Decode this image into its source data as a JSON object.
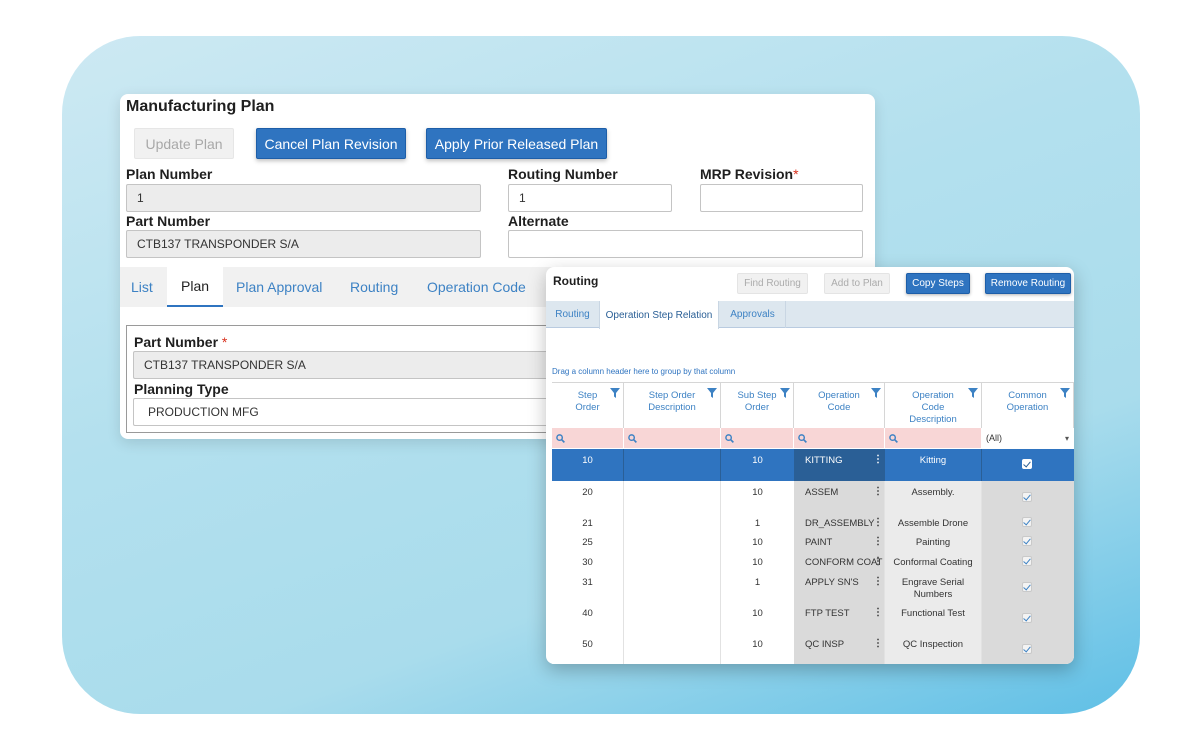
{
  "plan_window": {
    "title": "Manufacturing Plan",
    "buttons": {
      "update_plan": "Update Plan",
      "cancel_revision": "Cancel Plan Revision",
      "apply_prior": "Apply Prior Released Plan"
    },
    "fields": {
      "plan_number_label": "Plan Number",
      "plan_number_value": "1",
      "routing_number_label": "Routing Number",
      "routing_number_value": "1",
      "mrp_revision_label": "MRP Revision",
      "mrp_revision_value": "",
      "part_number_label": "Part Number",
      "part_number_value": "CTB137 TRANSPONDER S/A",
      "alternate_label": "Alternate",
      "alternate_value": ""
    },
    "required_mark": "*",
    "tabs": [
      "List",
      "Plan",
      "Plan Approval",
      "Routing",
      "Operation Code"
    ],
    "active_tab": "Plan",
    "detail": {
      "part_number_label": "Part Number",
      "part_number_value": "CTB137 TRANSPONDER S/A",
      "planning_type_label": "Planning Type",
      "planning_type_value": "PRODUCTION MFG"
    }
  },
  "routing_window": {
    "title": "Routing",
    "buttons": {
      "find_routing": "Find Routing",
      "add_to_plan": "Add to Plan",
      "copy_steps": "Copy Steps",
      "remove_routing": "Remove Routing"
    },
    "tabs": [
      "Routing",
      "Operation Step Relation",
      "Approvals"
    ],
    "active_tab": "Operation Step Relation",
    "group_hint": "Drag a column header here to group by that column",
    "columns": [
      {
        "line1": "Step",
        "line2": "Order",
        "line3": ""
      },
      {
        "line1": "Step Order",
        "line2": "Description",
        "line3": ""
      },
      {
        "line1": "Sub Step",
        "line2": "Order",
        "line3": ""
      },
      {
        "line1": "Operation",
        "line2": "Code",
        "line3": ""
      },
      {
        "line1": "Operation",
        "line2": "Code",
        "line3": "Description"
      },
      {
        "line1": "Common",
        "line2": "Operation",
        "line3": ""
      }
    ],
    "filter_all": "(All)",
    "rows": [
      {
        "step": "10",
        "step_desc": "",
        "sub_step": "10",
        "op_code": "KITTING",
        "op_desc": "Kitting",
        "common": true
      },
      {
        "step": "20",
        "step_desc": "",
        "sub_step": "10",
        "op_code": "ASSEM",
        "op_desc": "Assembly.",
        "common": true
      },
      {
        "step": "21",
        "step_desc": "",
        "sub_step": "1",
        "op_code": "DR_ASSEMBLY",
        "op_desc": "Assemble Drone",
        "common": true
      },
      {
        "step": "25",
        "step_desc": "",
        "sub_step": "10",
        "op_code": "PAINT",
        "op_desc": "Painting",
        "common": true
      },
      {
        "step": "30",
        "step_desc": "",
        "sub_step": "10",
        "op_code": "CONFORM COAT",
        "op_desc": "Conformal Coating",
        "common": true
      },
      {
        "step": "31",
        "step_desc": "",
        "sub_step": "1",
        "op_code": "APPLY SN'S",
        "op_desc": "Engrave Serial",
        "op_desc2": "Numbers",
        "common": true
      },
      {
        "step": "40",
        "step_desc": "",
        "sub_step": "10",
        "op_code": "FTP TEST",
        "op_desc": "Functional Test",
        "common": true
      },
      {
        "step": "50",
        "step_desc": "",
        "sub_step": "10",
        "op_code": "QC INSP",
        "op_desc": "QC Inspection",
        "common": true
      }
    ]
  },
  "colors": {
    "accent": "#2f74c0",
    "selected_row": "#2f74c0",
    "link_text": "#3d82c4",
    "filter_row": "#f8d6d6",
    "required": "#d9301d"
  }
}
